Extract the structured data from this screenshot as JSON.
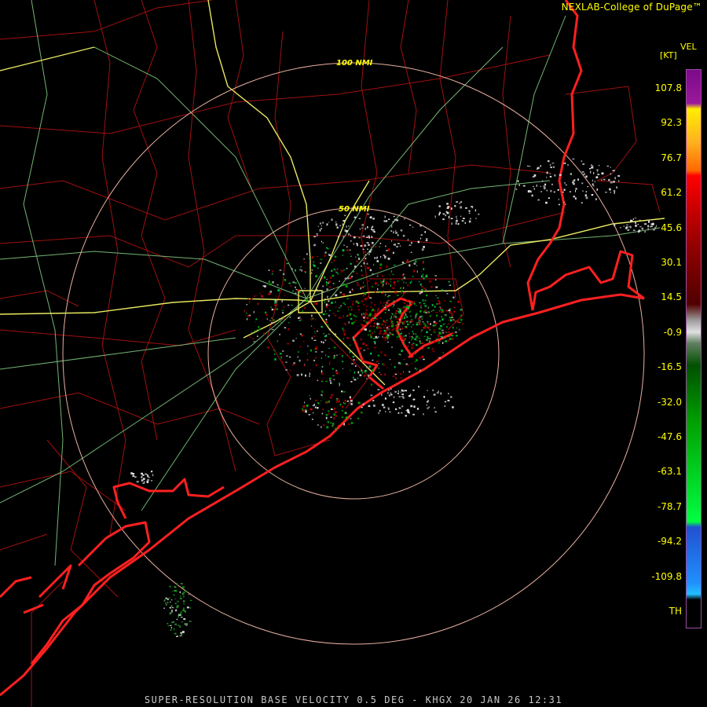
{
  "credit": "NEXLAB-College of DuPage",
  "credit_cut": "™",
  "product_title": "SUPER-RESOLUTION BASE VELOCITY 0.5 DEG - KHGX 20 JAN 26 12:31",
  "range_rings": [
    "50 NMI",
    "100 NMI"
  ],
  "scale": {
    "title": "VEL",
    "unit": "[KT]",
    "labels": [
      "107.8",
      "92.3",
      "76.7",
      "61.2",
      "45.6",
      "30.1",
      "14.5",
      "-0.9",
      "-16.5",
      "-32.0",
      "-47.6",
      "-63.1",
      "-78.7",
      "-94.2",
      "-109.8",
      "TH"
    ]
  },
  "colors": {
    "background": "#000000",
    "coastline": "#ff2020",
    "county_lines": "#a01010",
    "state_lines": "#ff2020",
    "highways": "#e8e860",
    "secondary_roads": "#80c880",
    "range_rings": "#e8b0a0",
    "inbound_velocity": "#00a000",
    "outbound_velocity": "#c00000",
    "near_zero_velocity": "#c8c8c8"
  }
}
